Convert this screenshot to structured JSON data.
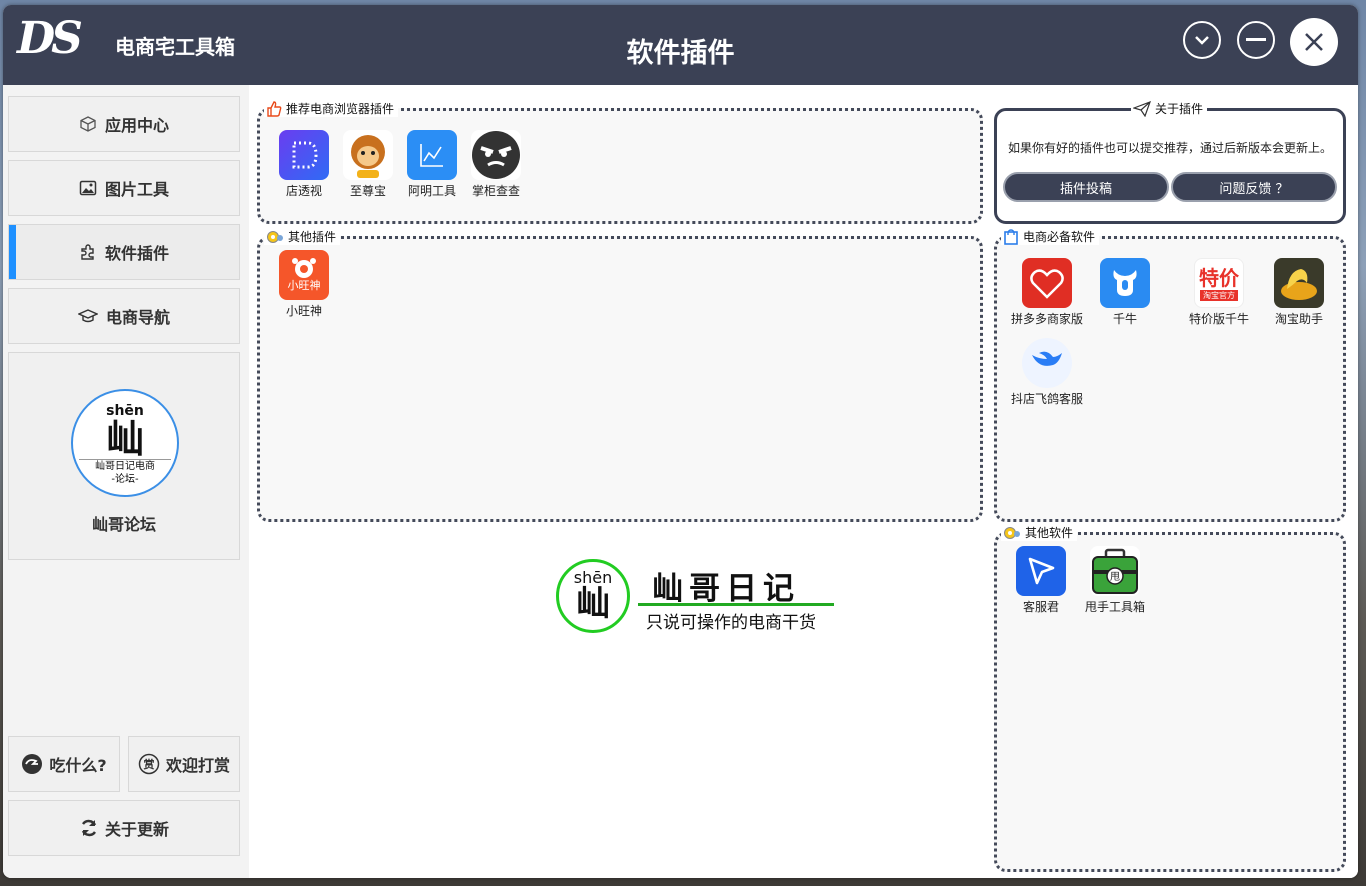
{
  "app": {
    "logo_text": "DS",
    "name": "电商宅工具箱",
    "page_title": "软件插件"
  },
  "sidebar": {
    "nav": [
      {
        "label": "应用中心",
        "icon": "box-icon"
      },
      {
        "label": "图片工具",
        "icon": "image-icon"
      },
      {
        "label": "软件插件",
        "icon": "puzzle-icon",
        "active": true
      },
      {
        "label": "电商导航",
        "icon": "graduation-cap-icon"
      }
    ],
    "forum": {
      "logo_pinyin": "shēn",
      "logo_char": "屾",
      "logo_sub1": "屾哥日记电商",
      "logo_sub2": "-论坛-",
      "label": "屾哥论坛"
    },
    "eat_label": "吃什么?",
    "donate_label": "欢迎打赏",
    "donate_icon_char": "赏",
    "update_label": "关于更新"
  },
  "groups": {
    "recommended": {
      "title": "推荐电商浏览器插件",
      "apps": [
        "店透视",
        "至尊宝",
        "阿明工具",
        "掌柜查查"
      ]
    },
    "other_plugins": {
      "title": "其他插件",
      "apps": [
        "小旺神"
      ],
      "xiaowang_icon_text": "小旺神"
    },
    "brand": {
      "pinyin": "shēn",
      "char": "屾",
      "name": "屾哥日记",
      "slogan": "只说可操作的电商干货"
    },
    "about": {
      "title": "关于插件",
      "text": "如果你有好的插件也可以提交推荐，通过后新版本会更新上。",
      "submit_label": "插件投稿",
      "feedback_label": "问题反馈 ？"
    },
    "essential": {
      "title": "电商必备软件",
      "apps": [
        "拼多多商家版",
        "千牛",
        "特价版千牛",
        "淘宝助手",
        "抖店飞鸽客服"
      ],
      "tejia_icon_text": "特价",
      "tejia_icon_sub": "淘宝官方"
    },
    "other_software": {
      "title": "其他软件",
      "apps": [
        "客服君",
        "甩手工具箱"
      ],
      "shuai_icon_char": "甩"
    }
  },
  "colors": {
    "titlebar": "#3b4155",
    "accent": "#1e90ff",
    "brand_green": "#22cc22"
  }
}
